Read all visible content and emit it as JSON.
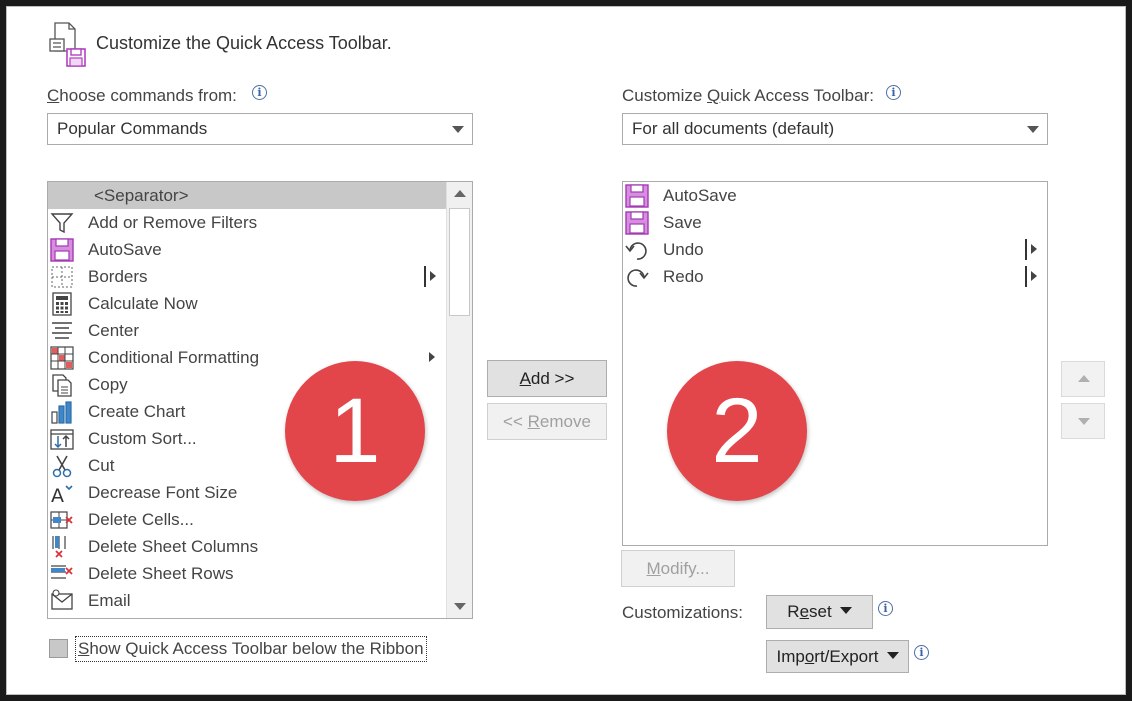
{
  "header": {
    "title": "Customize the Quick Access Toolbar."
  },
  "left": {
    "choose_label_first": "C",
    "choose_label_rest": "hoose commands from:",
    "choose_value": "Popular Commands",
    "items": [
      {
        "label": "<Separator>",
        "icon": "separator",
        "selected": true
      },
      {
        "label": "Add or Remove Filters",
        "icon": "filter-icon"
      },
      {
        "label": "AutoSave",
        "icon": "autosave-icon"
      },
      {
        "label": "Borders",
        "icon": "borders-icon",
        "submenu": "bar"
      },
      {
        "label": "Calculate Now",
        "icon": "calculator-icon"
      },
      {
        "label": "Center",
        "icon": "align-center-icon"
      },
      {
        "label": "Conditional Formatting",
        "icon": "conditional-formatting-icon",
        "submenu": "arrow"
      },
      {
        "label": "Copy",
        "icon": "copy-icon"
      },
      {
        "label": "Create Chart",
        "icon": "chart-icon"
      },
      {
        "label": "Custom Sort...",
        "icon": "sort-icon"
      },
      {
        "label": "Cut",
        "icon": "scissors-icon"
      },
      {
        "label": "Decrease Font Size",
        "icon": "decrease-font-icon"
      },
      {
        "label": "Delete Cells...",
        "icon": "delete-cells-icon"
      },
      {
        "label": "Delete Sheet Columns",
        "icon": "delete-columns-icon"
      },
      {
        "label": "Delete Sheet Rows",
        "icon": "delete-rows-icon"
      },
      {
        "label": "Email",
        "icon": "email-icon"
      }
    ]
  },
  "right": {
    "customize_label_pre": "Customize ",
    "customize_label_u": "Q",
    "customize_label_post": "uick Access Toolbar:",
    "customize_value": "For all documents (default)",
    "items": [
      {
        "label": "AutoSave",
        "icon": "autosave-icon"
      },
      {
        "label": "Save",
        "icon": "save-icon"
      },
      {
        "label": "Undo",
        "icon": "undo-icon",
        "submenu": "bar"
      },
      {
        "label": "Redo",
        "icon": "redo-icon",
        "submenu": "bar"
      }
    ]
  },
  "buttons": {
    "add_u": "A",
    "add_rest": "dd >>",
    "remove_pre": "<< ",
    "remove_u": "R",
    "remove_rest": "emove",
    "modify_u": "M",
    "modify_rest": "odify...",
    "reset_pre": "R",
    "reset_u": "e",
    "reset_rest": "set",
    "import_pre": "Imp",
    "import_u": "o",
    "import_rest": "rt/Export"
  },
  "customizations_label": "Customizations:",
  "show_below": {
    "u": "S",
    "rest": "how Quick Access Toolbar below the Ribbon",
    "checked": false
  },
  "badges": {
    "one": "1",
    "two": "2"
  },
  "colors": {
    "accent_purple": "#b040c0",
    "badge_red": "#e2454a",
    "selected_row": "#c8c8c8"
  }
}
